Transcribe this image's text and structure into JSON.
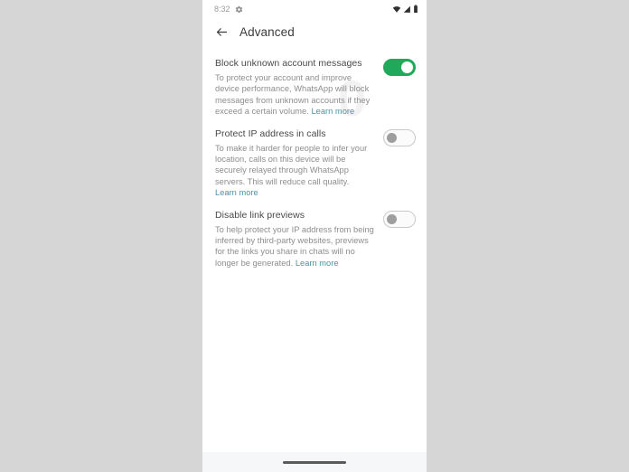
{
  "status_bar": {
    "time": "8:32",
    "gear_icon": "gear-icon",
    "wifi_icon": "wifi-icon",
    "signal_icon": "signal-icon",
    "battery_icon": "battery-icon"
  },
  "app_bar": {
    "back_icon": "back-arrow-icon",
    "title": "Advanced"
  },
  "settings": [
    {
      "title": "Block unknown account messages",
      "description": "To protect your account and improve device performance, WhatsApp will block messages from unknown accounts if they exceed a certain volume. ",
      "link_label": "Learn more",
      "link_inline": true,
      "toggle_state": "on"
    },
    {
      "title": "Protect IP address in calls",
      "description": "To make it harder for people to infer your location, calls on this device will be securely relayed through WhatsApp servers. This will reduce call quality.",
      "link_label": "Learn more",
      "link_inline": false,
      "toggle_state": "off"
    },
    {
      "title": "Disable link previews",
      "description": "To help protect your IP address from being inferred by third-party websites, previews for the links you share in chats will no longer be generated. ",
      "link_label": "Learn more",
      "link_inline": true,
      "toggle_state": "off"
    }
  ],
  "colors": {
    "toggle_on": "#20a95a",
    "link": "#4c93a8",
    "title_text": "#494949",
    "body_text": "#8d8d8d",
    "page_background": "#d6d6d6"
  },
  "gesture_bar": {
    "pill": "home-gesture-pill"
  }
}
